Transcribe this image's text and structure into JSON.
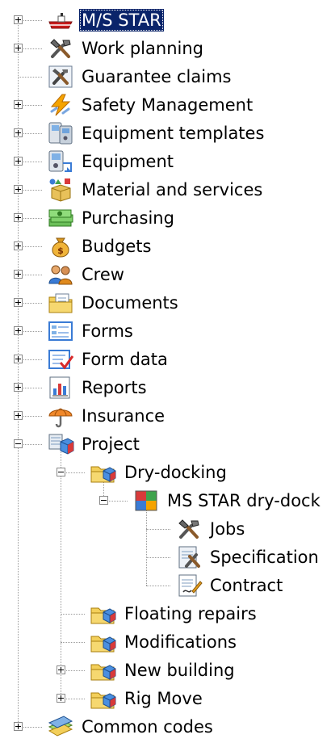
{
  "tree": {
    "items": [
      {
        "id": "ms-star",
        "label": "M/S STAR",
        "level": 0,
        "expander": "collapsed",
        "icon": "ship-icon",
        "selected": true
      },
      {
        "id": "work-planning",
        "label": "Work planning",
        "level": 0,
        "expander": "collapsed",
        "icon": "tools-icon"
      },
      {
        "id": "guarantee-claims",
        "label": "Guarantee claims",
        "level": 0,
        "expander": "none",
        "icon": "tools-box-icon"
      },
      {
        "id": "safety-management",
        "label": "Safety Management",
        "level": 0,
        "expander": "collapsed",
        "icon": "lightning-icon"
      },
      {
        "id": "equipment-templates",
        "label": "Equipment templates",
        "level": 0,
        "expander": "collapsed",
        "icon": "device-templates-icon"
      },
      {
        "id": "equipment",
        "label": "Equipment",
        "level": 0,
        "expander": "collapsed",
        "icon": "device-icon"
      },
      {
        "id": "material-and-services",
        "label": "Material and services",
        "level": 0,
        "expander": "collapsed",
        "icon": "material-box-icon"
      },
      {
        "id": "purchasing",
        "label": "Purchasing",
        "level": 0,
        "expander": "collapsed",
        "icon": "money-stack-icon"
      },
      {
        "id": "budgets",
        "label": "Budgets",
        "level": 0,
        "expander": "collapsed",
        "icon": "money-bag-icon"
      },
      {
        "id": "crew",
        "label": "Crew",
        "level": 0,
        "expander": "collapsed",
        "icon": "people-icon"
      },
      {
        "id": "documents",
        "label": "Documents",
        "level": 0,
        "expander": "collapsed",
        "icon": "folder-document-icon"
      },
      {
        "id": "forms",
        "label": "Forms",
        "level": 0,
        "expander": "collapsed",
        "icon": "form-icon"
      },
      {
        "id": "form-data",
        "label": "Form data",
        "level": 0,
        "expander": "collapsed",
        "icon": "form-check-icon"
      },
      {
        "id": "reports",
        "label": "Reports",
        "level": 0,
        "expander": "collapsed",
        "icon": "report-chart-icon"
      },
      {
        "id": "insurance",
        "label": "Insurance",
        "level": 0,
        "expander": "collapsed",
        "icon": "umbrella-icon"
      },
      {
        "id": "project",
        "label": "Project",
        "level": 0,
        "expander": "expanded",
        "icon": "project-icon"
      },
      {
        "id": "dry-docking",
        "label": "Dry-docking",
        "level": 1,
        "expander": "expanded",
        "icon": "folder-cube-icon"
      },
      {
        "id": "ms-star-dry-dock",
        "label": "MS STAR dry-dock",
        "level": 2,
        "expander": "expanded",
        "icon": "colorful-cube-icon"
      },
      {
        "id": "jobs",
        "label": "Jobs",
        "level": 3,
        "expander": "none",
        "icon": "tools-icon"
      },
      {
        "id": "specification",
        "label": "Specification",
        "level": 3,
        "expander": "none",
        "icon": "specification-icon"
      },
      {
        "id": "contract",
        "label": "Contract",
        "level": 3,
        "expander": "none",
        "icon": "contract-icon"
      },
      {
        "id": "floating-repairs",
        "label": "Floating repairs",
        "level": 1,
        "expander": "none",
        "icon": "folder-cube-icon"
      },
      {
        "id": "modifications",
        "label": "Modifications",
        "level": 1,
        "expander": "none",
        "icon": "folder-cube-icon"
      },
      {
        "id": "new-building",
        "label": "New building",
        "level": 1,
        "expander": "collapsed",
        "icon": "folder-cube-icon"
      },
      {
        "id": "rig-move",
        "label": "Rig Move",
        "level": 1,
        "expander": "collapsed",
        "icon": "folder-cube-icon"
      },
      {
        "id": "common-codes",
        "label": "Common codes",
        "level": 0,
        "expander": "collapsed",
        "icon": "codes-icon"
      }
    ]
  }
}
